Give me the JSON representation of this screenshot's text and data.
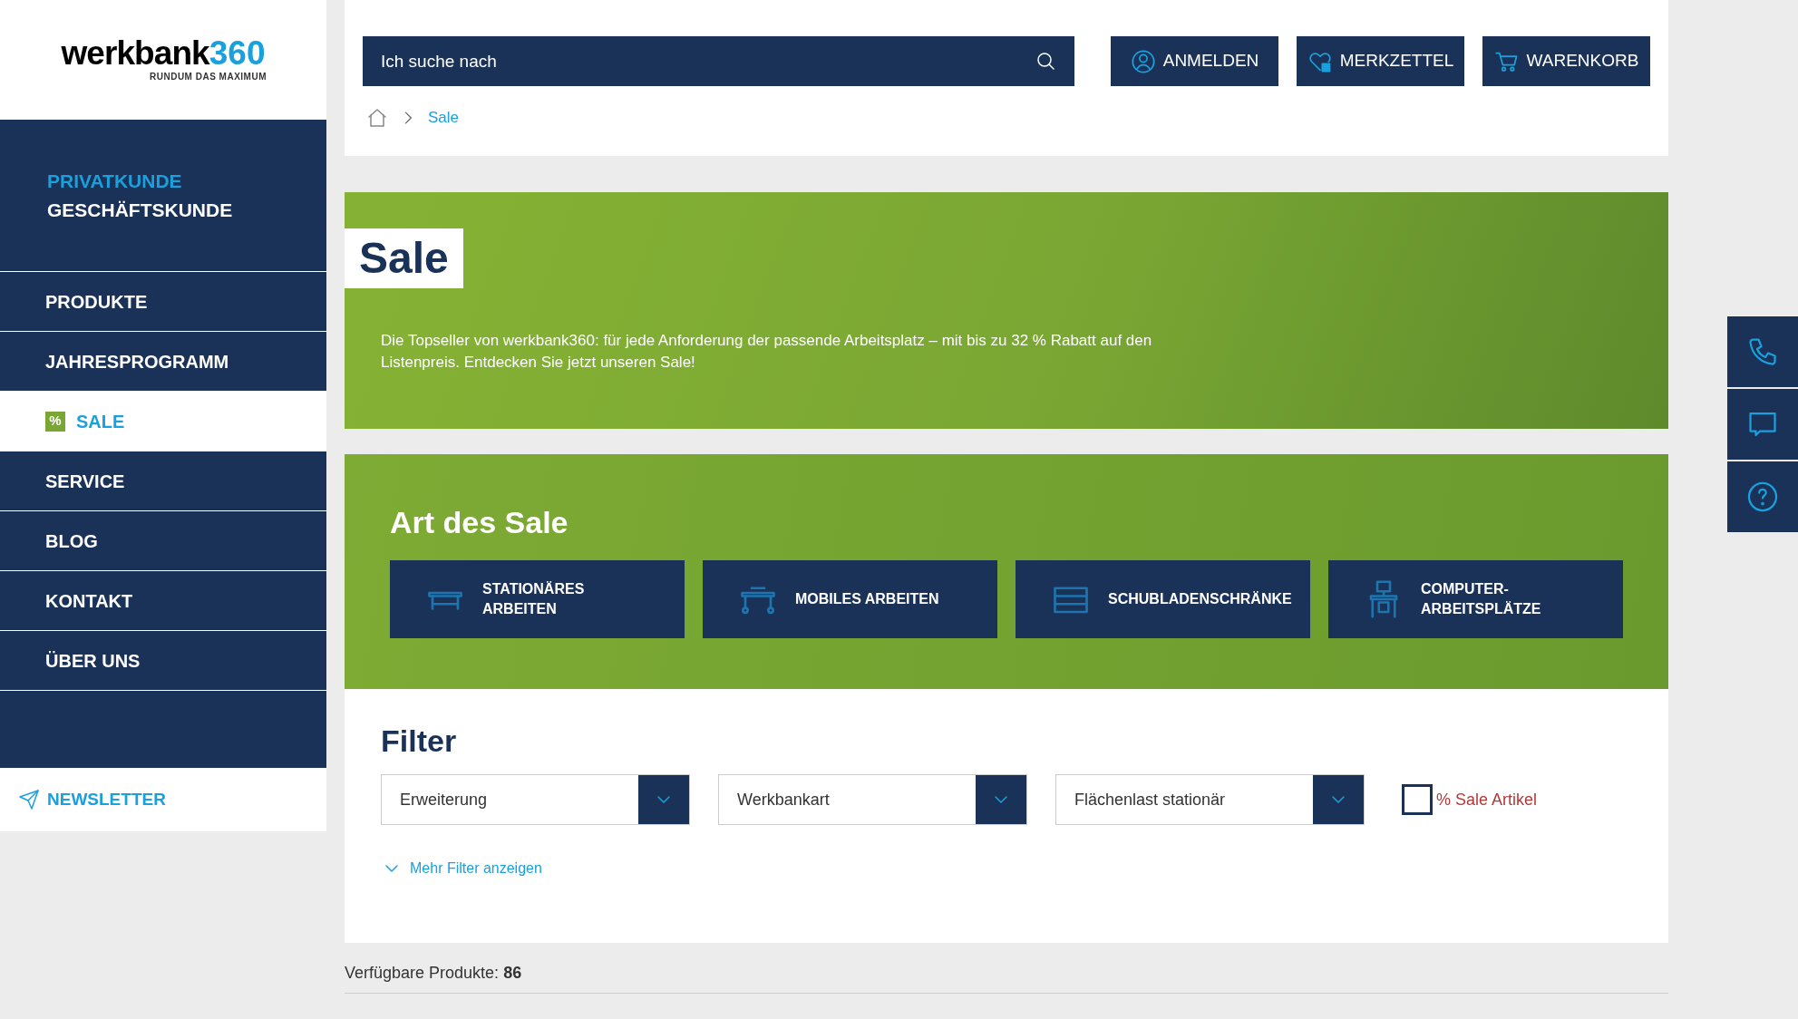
{
  "logo": {
    "wordmark": "werkbank",
    "number": "360",
    "tagline": "RUNDUM DAS MAXIMUM"
  },
  "customer_types": [
    {
      "label": "PRIVATKUNDE",
      "selected": true
    },
    {
      "label": "GESCHÄFTSKUNDE",
      "selected": false
    }
  ],
  "sidebar": {
    "items": [
      {
        "label": "PRODUKTE",
        "selected": false
      },
      {
        "label": "JAHRESPROGRAMM",
        "selected": false
      },
      {
        "label": "SALE",
        "selected": true,
        "badge": "%"
      },
      {
        "label": "SERVICE",
        "selected": false
      },
      {
        "label": "BLOG",
        "selected": false
      },
      {
        "label": "KONTAKT",
        "selected": false
      },
      {
        "label": "ÜBER UNS",
        "selected": false
      }
    ],
    "newsletter": "NEWSLETTER"
  },
  "search": {
    "placeholder": "Ich suche nach"
  },
  "header_buttons": [
    {
      "kind": "user",
      "label": "ANMELDEN"
    },
    {
      "kind": "wishlist",
      "label": "MERKZETTEL"
    },
    {
      "kind": "cart",
      "label": "WARENKORB"
    }
  ],
  "breadcrumb": [
    "Sale"
  ],
  "banner": {
    "title": "Sale",
    "text": "Die Topseller von werkbank360: für jede Anforderung der passende Arbeitsplatz – mit bis zu 32 % Rabatt auf den Listenpreis. Entdecken Sie jetzt unseren Sale!"
  },
  "sale_types": {
    "title": "Art des Sale",
    "items": [
      {
        "kind": "bench",
        "label": "STATIONÄRES ARBEITEN"
      },
      {
        "kind": "mobile",
        "label": "MOBILES ARBEITEN"
      },
      {
        "kind": "drawers",
        "label": "SCHUBLADENSCHRÄNKE"
      },
      {
        "kind": "computer",
        "label": "COMPUTER-ARBEITSPLÄTZE"
      }
    ]
  },
  "filter": {
    "title": "Filter",
    "selects": [
      "Erweiterung",
      "Werkbankart",
      "Flächenlast stationär"
    ],
    "checkbox": {
      "label": "% Sale Artikel",
      "checked": false
    },
    "more": "Mehr Filter anzeigen"
  },
  "results": {
    "label": "Verfügbare Produkte:",
    "count": "86"
  },
  "side_tabs": [
    {
      "kind": "phone"
    },
    {
      "kind": "chat"
    },
    {
      "kind": "help"
    }
  ]
}
